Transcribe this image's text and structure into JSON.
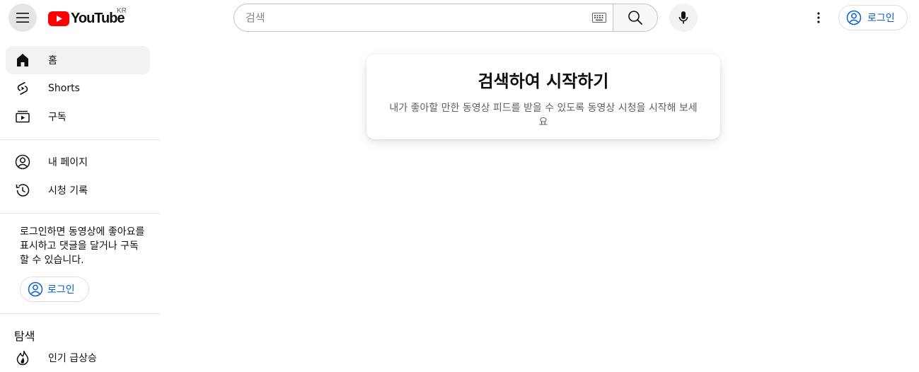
{
  "header": {
    "logo_text": "YouTube",
    "region": "KR",
    "search_placeholder": "검색",
    "signin_label": "로그인"
  },
  "sidebar": {
    "items": [
      {
        "label": "홈",
        "icon": "home-icon",
        "active": true
      },
      {
        "label": "Shorts",
        "icon": "shorts-icon"
      },
      {
        "label": "구독",
        "icon": "subscriptions-icon"
      },
      {
        "label": "내 페이지",
        "icon": "account-icon"
      },
      {
        "label": "시청 기록",
        "icon": "history-icon"
      }
    ],
    "signin_note": "로그인하면 동영상에 좋아요를 표시하고 댓글을 달거나 구독할 수 있습니다.",
    "signin_label": "로그인",
    "explore_title": "탐색",
    "explore_items": [
      {
        "label": "인기 급상승",
        "icon": "trending-icon"
      }
    ]
  },
  "main": {
    "card_title": "검색하여 시작하기",
    "card_description": "내가 좋아할 만한 동영상 피드를 받을 수 있도록 동영상 시청을 시작해 보세요"
  },
  "colors": {
    "brand_red": "#ff0000",
    "link_blue": "#065fd4"
  }
}
